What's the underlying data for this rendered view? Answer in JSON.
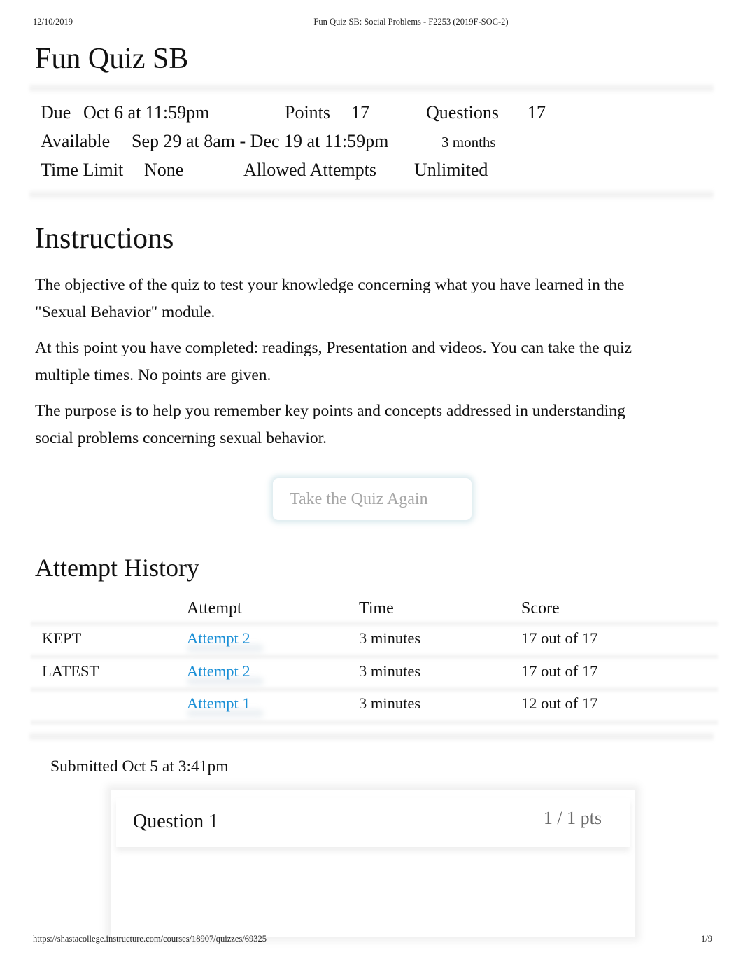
{
  "print_header": {
    "date": "12/10/2019",
    "document_title": "Fun Quiz SB: Social Problems - F2253 (2019F-SOC-2)"
  },
  "quiz": {
    "title": "Fun Quiz SB",
    "details": {
      "due_label": "Due",
      "due_value": "Oct 6 at 11:59pm",
      "points_label": "Points",
      "points_value": "17",
      "questions_label": "Questions",
      "questions_value": "17",
      "available_label": "Available",
      "available_value": "Sep 29 at 8am - Dec 19 at 11:59pm",
      "available_duration": "3 months",
      "time_limit_label": "Time Limit",
      "time_limit_value": "None",
      "allowed_attempts_label": "Allowed Attempts",
      "allowed_attempts_value": "Unlimited"
    }
  },
  "instructions": {
    "title": "Instructions",
    "paragraphs": [
      "The objective of the quiz to test your knowledge concerning what you have learned in the \"Sexual Behavior\" module.",
      "At this point you have completed: readings, Presentation and videos. You can take the quiz multiple times. No points are given.",
      "The purpose is to help you remember key points and concepts addressed in understanding social problems concerning sexual behavior."
    ]
  },
  "actions": {
    "retake_label": "Take the Quiz Again"
  },
  "attempt_history": {
    "title": "Attempt History",
    "columns": [
      "",
      "Attempt",
      "Time",
      "Score"
    ],
    "rows": [
      {
        "label": "KEPT",
        "attempt": "Attempt 2",
        "time": "3 minutes",
        "score": "17 out of 17"
      },
      {
        "label": "LATEST",
        "attempt": "Attempt 2",
        "time": "3 minutes",
        "score": "17 out of 17"
      },
      {
        "label": "",
        "attempt": "Attempt 1",
        "time": "3 minutes",
        "score": "12 out of 17"
      }
    ]
  },
  "submission": {
    "submitted_text": "Submitted Oct 5 at 3:41pm"
  },
  "questions": [
    {
      "title": "Question 1",
      "points": "1 / 1 pts"
    }
  ],
  "print_footer": {
    "url": "https://shastacollege.instructure.com/courses/18907/quizzes/69325",
    "page": "1/9"
  },
  "colors": {
    "link": "#1a8fd6",
    "muted_text": "#a6a6a6",
    "points_text": "#6b6b6b"
  }
}
